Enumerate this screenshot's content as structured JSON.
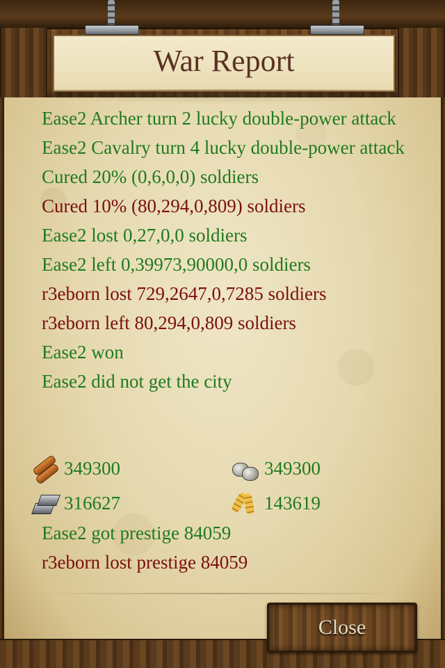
{
  "header": {
    "title": "War Report"
  },
  "report_lines": [
    {
      "text": "Ease2  Archer turn 2 lucky double-power attack",
      "color": "green"
    },
    {
      "text": "Ease2  Cavalry turn 4 lucky double-power attack",
      "color": "green"
    },
    {
      "text": "Cured 20% (0,6,0,0) soldiers",
      "color": "green"
    },
    {
      "text": "Cured 10% (80,294,0,809) soldiers",
      "color": "red"
    },
    {
      "text": "Ease2 lost 0,27,0,0 soldiers",
      "color": "green"
    },
    {
      "text": "Ease2 left 0,39973,90000,0 soldiers",
      "color": "green"
    },
    {
      "text": "r3eborn lost 729,2647,0,7285 soldiers",
      "color": "red"
    },
    {
      "text": "r3eborn left 80,294,0,809 soldiers",
      "color": "red"
    },
    {
      "text": "Ease2 won",
      "color": "green"
    },
    {
      "text": "Ease2 did not get the city",
      "color": "green"
    }
  ],
  "resources": {
    "wood": {
      "icon": "wood-icon",
      "value": "349300"
    },
    "stone": {
      "icon": "stone-icon",
      "value": "349300"
    },
    "iron": {
      "icon": "iron-icon",
      "value": "316627"
    },
    "food": {
      "icon": "food-icon",
      "value": "143619"
    }
  },
  "prestige_lines": [
    {
      "text": "Ease2 got prestige 84059",
      "color": "green"
    },
    {
      "text": "r3eborn lost prestige 84059",
      "color": "red"
    }
  ],
  "footer": {
    "close_label": "Close"
  },
  "colors": {
    "green": "#1f7a1f",
    "red": "#7a0f0f",
    "title": "#5a3224"
  }
}
